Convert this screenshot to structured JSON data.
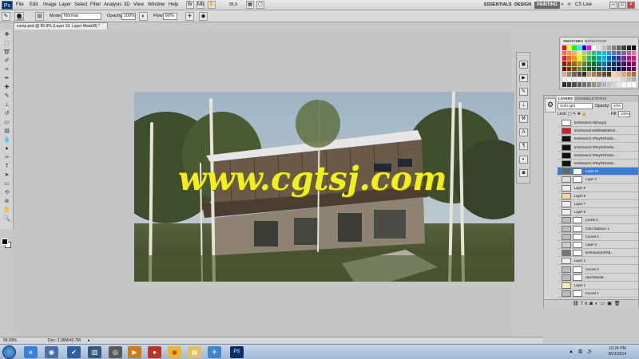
{
  "menubar": {
    "logo": "Ps",
    "items": [
      "File",
      "Edit",
      "Image",
      "Layer",
      "Select",
      "Filter",
      "Analysis",
      "3D",
      "View",
      "Window",
      "Help"
    ],
    "zoom": "95.9",
    "workspaces": [
      "ESSENTIALS",
      "DESIGN",
      "PAINTING"
    ],
    "cs_live": "CS Live"
  },
  "options": {
    "brush_size": "300",
    "mode_label": "Mode:",
    "mode_value": "Normal",
    "opacity_label": "Opacity:",
    "opacity_value": "100%",
    "flow_label": "Flow:",
    "flow_value": "66%"
  },
  "document": {
    "tab_title": "comp.psd @ 95.9% (Layer 10, Layer Mask/8) *",
    "watermark": "www.cgtsj.com"
  },
  "status": {
    "zoom": "95.93%",
    "doc": "Doc: 2.06M/42.7M"
  },
  "swatches": {
    "tabs": [
      "SWATCHES",
      "NAVIGATION"
    ],
    "colors": [
      "#ff0000",
      "#ffff00",
      "#00ff00",
      "#00ffff",
      "#0000ff",
      "#ff00ff",
      "#ffffff",
      "#e0e0e0",
      "#c0c0c0",
      "#a0a0a0",
      "#808080",
      "#606060",
      "#404040",
      "#202020",
      "#000000",
      "#f26c4f",
      "#f68e55",
      "#fbaf5c",
      "#fff467",
      "#acd372",
      "#7cc576",
      "#3bb878",
      "#1abbb4",
      "#00bff3",
      "#438ccb",
      "#5574b9",
      "#605ca8",
      "#855fa8",
      "#a763a8",
      "#f06ea9",
      "#ed1c24",
      "#f26522",
      "#f7941d",
      "#fff200",
      "#8dc63f",
      "#39b54a",
      "#00a651",
      "#00a99d",
      "#00aeef",
      "#0072bc",
      "#0054a6",
      "#2e3192",
      "#662d91",
      "#92278f",
      "#ec008c",
      "#9e0b0f",
      "#a0410d",
      "#a3620a",
      "#aba000",
      "#598527",
      "#197b30",
      "#007236",
      "#00746b",
      "#0076a3",
      "#004a80",
      "#003471",
      "#1b1464",
      "#440e62",
      "#630460",
      "#9e005d",
      "#790000",
      "#7b2e00",
      "#7d4900",
      "#827b00",
      "#406618",
      "#005e20",
      "#005826",
      "#005952",
      "#005b7f",
      "#003663",
      "#002157",
      "#0d004c",
      "#32004b",
      "#4b0049",
      "#7b0046",
      "#c7b299",
      "#998675",
      "#736357",
      "#534741",
      "#37302d",
      "#c69c6d",
      "#a67c52",
      "#8c6239",
      "#754c24",
      "#603913",
      "#f5d5b8",
      "#e8c3a0",
      "#d9a77e",
      "#c48a5c",
      "#a86d3f",
      "#ffe6e6",
      "#e6ffe6",
      "#e6e6ff",
      "#ffffe6",
      "#ffe6ff",
      "#e6ffff",
      "#fff0d9",
      "#d9f0ff",
      "#f0d9ff",
      "#d9ffd9",
      "#ffd9d9",
      "#eaeaea",
      "#d5d5d5",
      "#bfbfbf",
      "#aaaaaa",
      "#2b2b2b",
      "#3c3c3c",
      "#4d4d4d",
      "#5e5e5e",
      "#6f6f6f",
      "#7f7f7f",
      "#909090",
      "#a1a1a1",
      "#b2b2b2",
      "#c3c3c3",
      "#d4d4d4",
      "#e5e5e5",
      "#f6f6f6",
      "#fafafa",
      "#ffffff"
    ]
  },
  "layers": {
    "tabs": [
      "LAYERS",
      "CHANNELS",
      "PATHS"
    ],
    "blend_mode": "Soft Light",
    "opacity_label": "Opacity:",
    "opacity_value": "40%",
    "lock_label": "Lock:",
    "fill_label": "Fill:",
    "fill_value": "100%",
    "items": [
      {
        "name": "testHouse3.Alpha.jpg",
        "visible": false,
        "mask": false,
        "thumb": "#ffffff",
        "selected": false
      },
      {
        "name": "testHouse3.MultiMatteElem...",
        "visible": false,
        "mask": false,
        "thumb": "#c22",
        "selected": false
      },
      {
        "name": "testHouse3.VRayRefractio...",
        "visible": false,
        "mask": false,
        "thumb": "#111",
        "selected": false
      },
      {
        "name": "testHouse3.VRayRefractio...",
        "visible": false,
        "mask": false,
        "thumb": "#111",
        "selected": false
      },
      {
        "name": "testHouse3.VRayRefractio...",
        "visible": false,
        "mask": false,
        "thumb": "#111",
        "selected": false
      },
      {
        "name": "testHouse3.VRayRefractio...",
        "visible": false,
        "mask": false,
        "thumb": "#111",
        "selected": false
      },
      {
        "name": "Layer 10",
        "visible": true,
        "mask": true,
        "thumb": "#666",
        "selected": true
      },
      {
        "name": "Layer 3",
        "visible": true,
        "mask": true,
        "thumb": "#ddd",
        "selected": false
      },
      {
        "name": "Layer 9",
        "visible": true,
        "mask": false,
        "thumb": "#eee",
        "selected": false
      },
      {
        "name": "Layer 8",
        "visible": true,
        "mask": false,
        "thumb": "#f3d9a0",
        "selected": false
      },
      {
        "name": "Layer 7",
        "visible": true,
        "mask": false,
        "thumb": "#eee",
        "selected": false
      },
      {
        "name": "Layer 6",
        "visible": true,
        "mask": false,
        "thumb": "#eee",
        "selected": false
      },
      {
        "name": "Levels 2",
        "visible": true,
        "mask": true,
        "thumb": "#bbb",
        "selected": false
      },
      {
        "name": "Color Balance 1",
        "visible": true,
        "mask": true,
        "thumb": "#bbb",
        "selected": false
      },
      {
        "name": "Curves 4",
        "visible": true,
        "mask": true,
        "thumb": "#bbb",
        "selected": false
      },
      {
        "name": "Layer 4",
        "visible": true,
        "mask": true,
        "thumb": "#ccc",
        "selected": false
      },
      {
        "name": "testHouse3.RGB...",
        "visible": true,
        "mask": true,
        "thumb": "#777",
        "selected": false
      },
      {
        "name": "Layer 2",
        "visible": true,
        "mask": false,
        "thumb": "#eee",
        "selected": false
      },
      {
        "name": "Curves 2",
        "visible": true,
        "mask": true,
        "thumb": "#bbb",
        "selected": false
      },
      {
        "name": "Hue/Saturat...",
        "visible": true,
        "mask": true,
        "thumb": "#bbb",
        "selected": false
      },
      {
        "name": "Layer 1",
        "visible": true,
        "mask": false,
        "thumb": "#f5e9b0",
        "selected": false
      },
      {
        "name": "Curves 1",
        "visible": true,
        "mask": true,
        "thumb": "#bbb",
        "selected": false
      }
    ]
  },
  "taskbar": {
    "time": "10:24 PM",
    "date": "8/21/2014",
    "app_labels": [
      "PS"
    ]
  }
}
